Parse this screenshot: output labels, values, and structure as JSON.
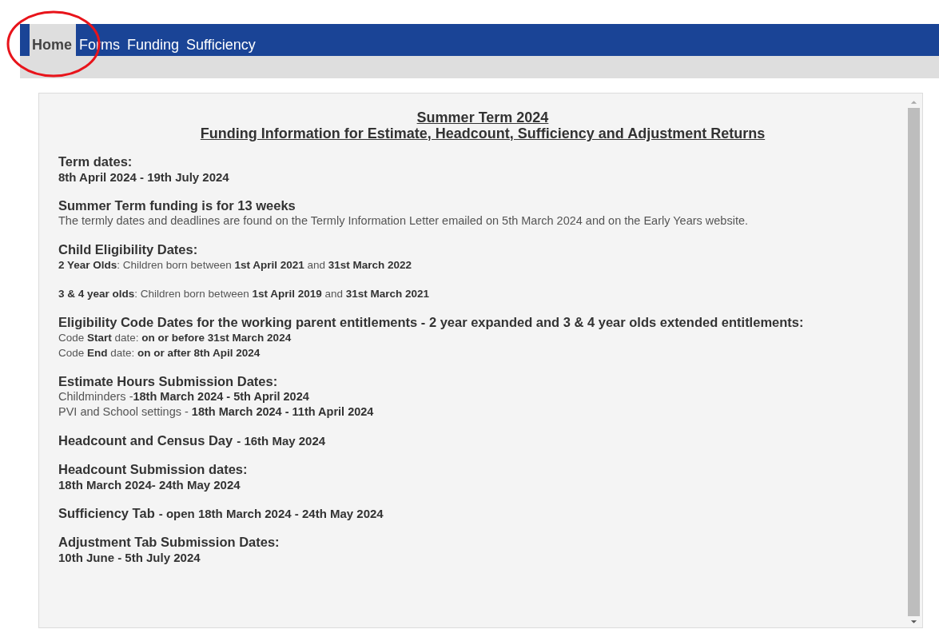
{
  "nav": {
    "tabs": [
      {
        "label": "Home",
        "selected": true
      },
      {
        "label": "Forms",
        "selected": false
      },
      {
        "label": "Funding",
        "selected": false
      },
      {
        "label": "Sufficiency",
        "selected": false
      }
    ]
  },
  "content": {
    "title": [
      "Summer Term 2024",
      "Funding Information for Estimate, Headcount, Sufficiency and Adjustment Returns"
    ],
    "sections": [
      {
        "lines": [
          {
            "kind": "heading",
            "text": "Term dates:"
          },
          {
            "kind": "strong",
            "text": "8th April 2024 - 19th July 2024"
          }
        ]
      },
      {
        "lines": [
          {
            "kind": "heading",
            "text": "Summer Term funding is for 13 weeks"
          },
          {
            "kind": "text",
            "text": "The termly dates and deadlines are found on the Termly Information Letter emailed on 5th March 2024 and on the Early Years website."
          }
        ]
      },
      {
        "lines": [
          {
            "kind": "heading",
            "text": "Child Eligibility Dates:"
          },
          {
            "kind": "small",
            "text": "**2 Year Olds**: Children born between **1st April 2021** and **31st March 2022**"
          }
        ]
      },
      {
        "lines": [
          {
            "kind": "small",
            "text": "**3 & 4 year olds**: Children born between **1st April 2019** and **31st March 2021**"
          }
        ]
      },
      {
        "lines": [
          {
            "kind": "heading",
            "text": "Eligibility Code Dates for the working parent entitlements - 2 year expanded and 3 & 4 year olds extended entitlements:"
          },
          {
            "kind": "small",
            "text": "Code **Start** date: **on or before 31st March 2024**"
          },
          {
            "kind": "small",
            "text": "Code **End** date: **on or after 8th Apil 2024**"
          }
        ]
      },
      {
        "lines": [
          {
            "kind": "heading",
            "text": "Estimate Hours Submission Dates:"
          },
          {
            "kind": "text",
            "text": "Childminders -**18th March 2024 - 5th April 2024**"
          },
          {
            "kind": "text",
            "text": "PVI and School settings - **18th March 2024 - 11th April 2024**"
          }
        ]
      },
      {
        "lines": [
          {
            "kind": "heading",
            "text": "Headcount and Census Day",
            "suffix": "- 16th May 2024"
          }
        ]
      },
      {
        "lines": [
          {
            "kind": "heading",
            "text": "Headcount Submission dates:"
          },
          {
            "kind": "strong",
            "text": "18th March 2024- 24th May 2024"
          }
        ]
      },
      {
        "lines": [
          {
            "kind": "heading",
            "text": "Sufficiency Tab",
            "suffix": "- open 18th March 2024 - 24th May 2024"
          }
        ]
      },
      {
        "lines": [
          {
            "kind": "heading",
            "text": "Adjustment Tab Submission Dates:"
          },
          {
            "kind": "strong",
            "text": "10th June - 5th July 2024"
          }
        ]
      }
    ]
  }
}
